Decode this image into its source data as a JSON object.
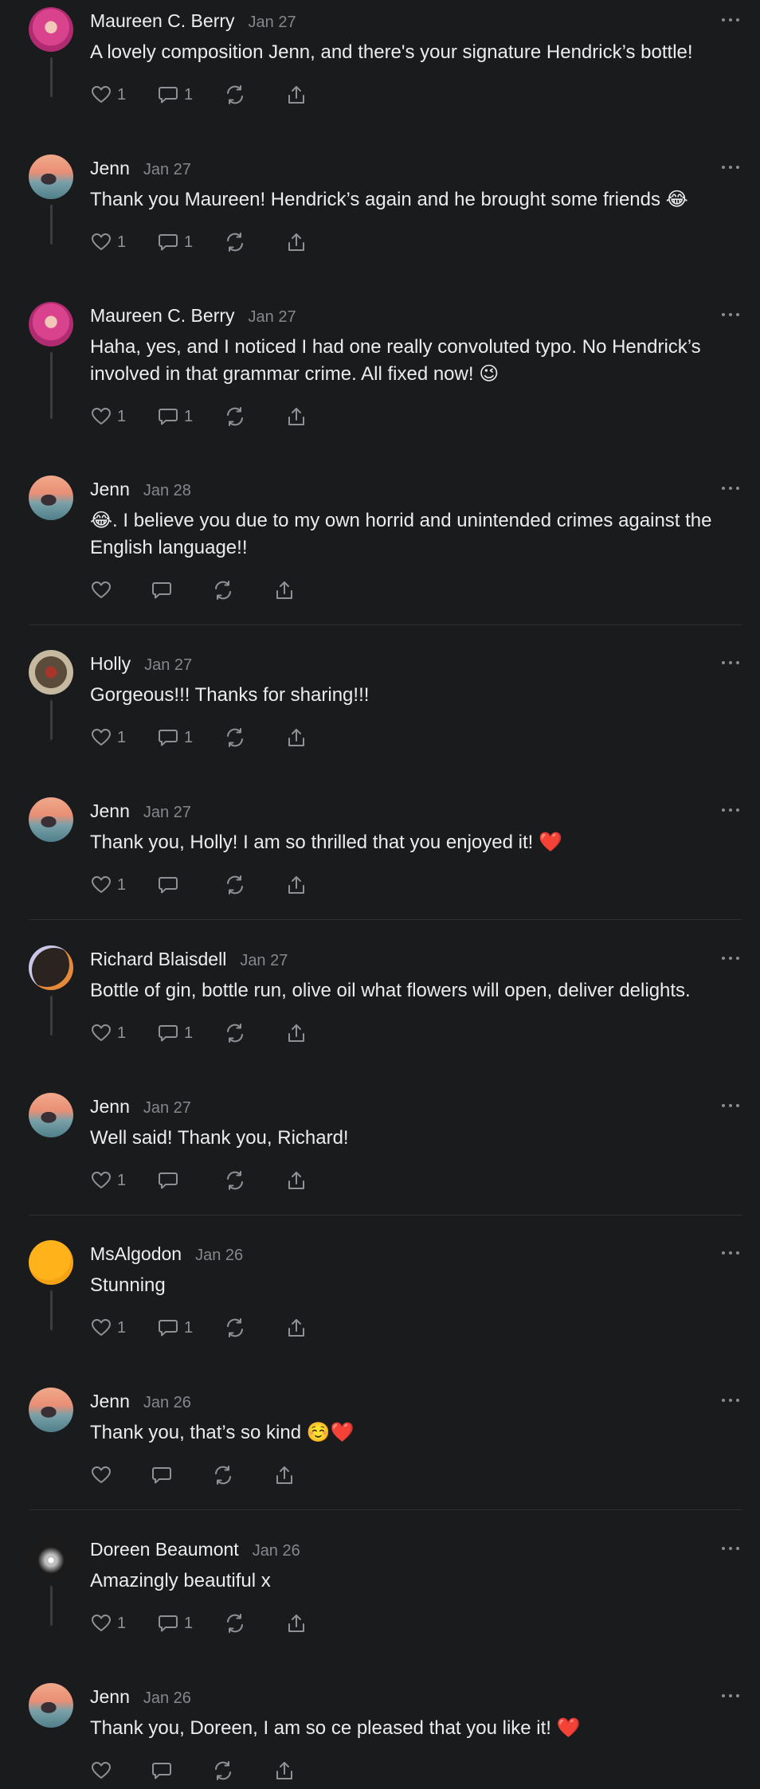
{
  "comments": [
    {
      "author": "Maureen C. Berry",
      "date": "Jan 27",
      "avatar": "maureen",
      "text": [
        "A lovely composition Jenn, and there's your signature Hendrick’s bottle!"
      ],
      "likes": "1",
      "replies": "1"
    },
    {
      "author": "Jenn",
      "date": "Jan 27",
      "avatar": "jenn",
      "text": [
        "Thank you Maureen! Hendrick’s again and he brought some friends 😂"
      ],
      "likes": "1",
      "replies": "1"
    },
    {
      "author": "Maureen C. Berry",
      "date": "Jan 27",
      "avatar": "maureen",
      "text": [
        "Haha, yes, and I noticed I had one really convoluted typo. No Hendrick’s",
        "involved in that grammar crime. All fixed now! 😉"
      ],
      "likes": "1",
      "replies": "1"
    },
    {
      "author": "Jenn",
      "date": "Jan 28",
      "avatar": "jenn",
      "text": [
        "😂. I believe you due to my own horrid and unintended crimes against the",
        "English language!!"
      ],
      "likes": "",
      "replies": ""
    },
    {
      "author": "Holly",
      "date": "Jan 27",
      "avatar": "holly",
      "text": [
        "Gorgeous!!! Thanks for sharing!!!"
      ],
      "likes": "1",
      "replies": "1"
    },
    {
      "author": "Jenn",
      "date": "Jan 27",
      "avatar": "jenn",
      "text": [
        "Thank you, Holly! I am so thrilled that you enjoyed it! ❤️"
      ],
      "likes": "1",
      "replies": ""
    },
    {
      "author": "Richard Blaisdell",
      "date": "Jan 27",
      "avatar": "richard",
      "text": [
        "Bottle of gin, bottle run, olive oil what flowers will open, deliver delights."
      ],
      "likes": "1",
      "replies": "1"
    },
    {
      "author": "Jenn",
      "date": "Jan 27",
      "avatar": "jenn",
      "text": [
        "Well said! Thank you, Richard!"
      ],
      "likes": "1",
      "replies": ""
    },
    {
      "author": "MsAlgodon",
      "date": "Jan 26",
      "avatar": "msalgodon",
      "text": [
        "Stunning"
      ],
      "likes": "1",
      "replies": "1"
    },
    {
      "author": "Jenn",
      "date": "Jan 26",
      "avatar": "jenn",
      "text": [
        "Thank you, that’s so kind ☺️❤️"
      ],
      "likes": "",
      "replies": ""
    },
    {
      "author": "Doreen Beaumont",
      "date": "Jan 26",
      "avatar": "doreen",
      "text": [
        "Amazingly beautiful x"
      ],
      "likes": "1",
      "replies": "1"
    },
    {
      "author": "Jenn",
      "date": "Jan 26",
      "avatar": "jenn",
      "text": [
        "Thank you, Doreen, I am so ce pleased that you like it! ❤️"
      ],
      "likes": "",
      "replies": ""
    }
  ]
}
